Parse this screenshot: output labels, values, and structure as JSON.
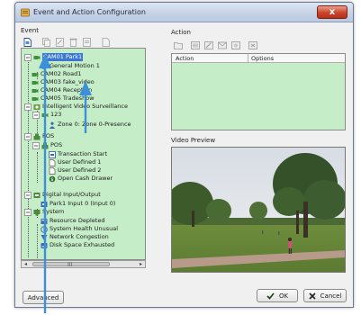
{
  "window": {
    "title": "Event and Action Configuration",
    "close_label": "x"
  },
  "event_group": {
    "label": "Event"
  },
  "action_group": {
    "label": "Action",
    "columns": [
      "Action",
      "Options"
    ]
  },
  "video_preview": {
    "label": "Video Preview"
  },
  "tree": {
    "items": [
      {
        "label": "CAM01 Park1",
        "selected": true
      },
      {
        "label": "General Motion 1"
      },
      {
        "label": "CAM02 Road1"
      },
      {
        "label": "CAM03 fake_video"
      },
      {
        "label": "CAM04 Reception"
      },
      {
        "label": "CAM05 Tradeshow"
      },
      {
        "label": "Intelligent Video Surveillance"
      },
      {
        "label": "123"
      },
      {
        "label": "Zone 0: Zone 0-Presence"
      },
      {
        "label": "POS"
      },
      {
        "label": "POS"
      },
      {
        "label": "Transaction Start"
      },
      {
        "label": "User Defined 1"
      },
      {
        "label": "User Defined 2"
      },
      {
        "label": "Open Cash Drawer"
      },
      {
        "label": "Digital Input/Output"
      },
      {
        "label": "Park1 Input 0 (Input 0)"
      },
      {
        "label": "System"
      },
      {
        "label": "Resource Depleted"
      },
      {
        "label": "System Health Unusual"
      },
      {
        "label": "Network Congestion"
      },
      {
        "label": "Disk Space Exhausted"
      }
    ]
  },
  "buttons": {
    "advanced": "Advanced",
    "ok": "OK",
    "cancel": "Cancel"
  },
  "scrollbar": {
    "left_arrow": "◂",
    "right_arrow": "▸",
    "grip": "III"
  },
  "colors": {
    "tree_background": "#c5eec8",
    "selection": "#3a78d4",
    "annotation_arrow": "#3d8fd8",
    "close_button": "#c9452b"
  }
}
